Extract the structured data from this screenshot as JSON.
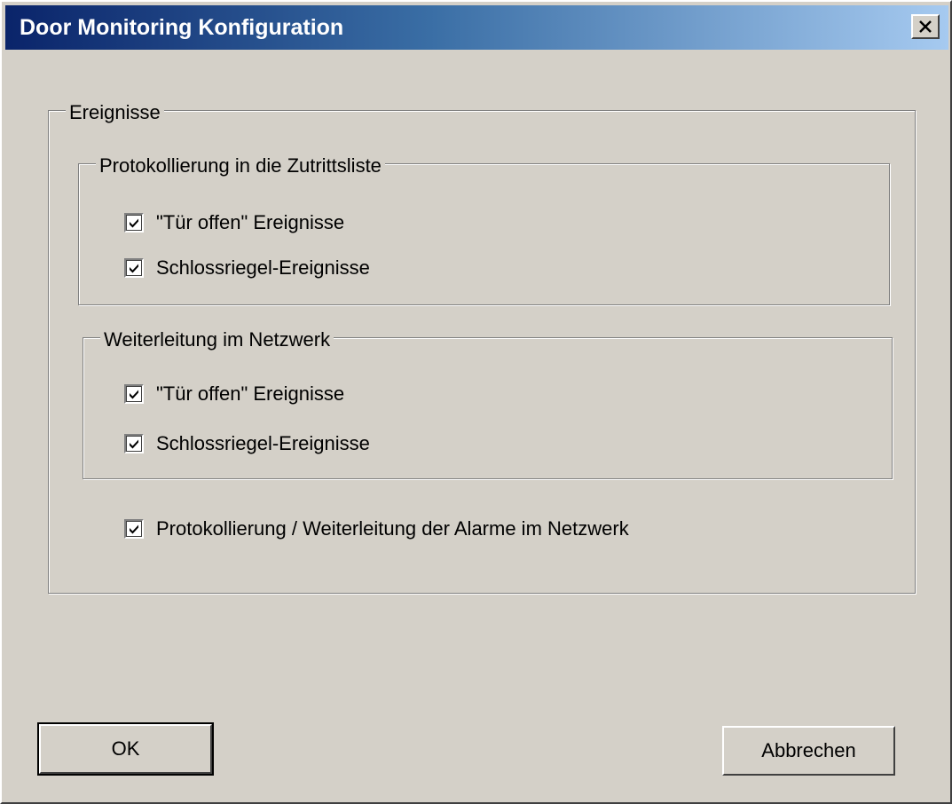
{
  "window": {
    "title": "Door Monitoring Konfiguration"
  },
  "events_group": {
    "label": "Ereignisse",
    "logging_group": {
      "label": "Protokollierung in die Zutrittsliste",
      "door_open": {
        "label": "\"Tür offen\" Ereignisse",
        "checked": true
      },
      "lock_bolt": {
        "label": "Schlossriegel-Ereignisse",
        "checked": true
      }
    },
    "network_group": {
      "label": "Weiterleitung im Netzwerk",
      "door_open": {
        "label": "\"Tür offen\" Ereignisse",
        "checked": true
      },
      "lock_bolt": {
        "label": "Schlossriegel-Ereignisse",
        "checked": true
      }
    },
    "alarms": {
      "label": "Protokollierung / Weiterleitung der Alarme im Netzwerk",
      "checked": true
    }
  },
  "buttons": {
    "ok": "OK",
    "cancel": "Abbrechen"
  }
}
